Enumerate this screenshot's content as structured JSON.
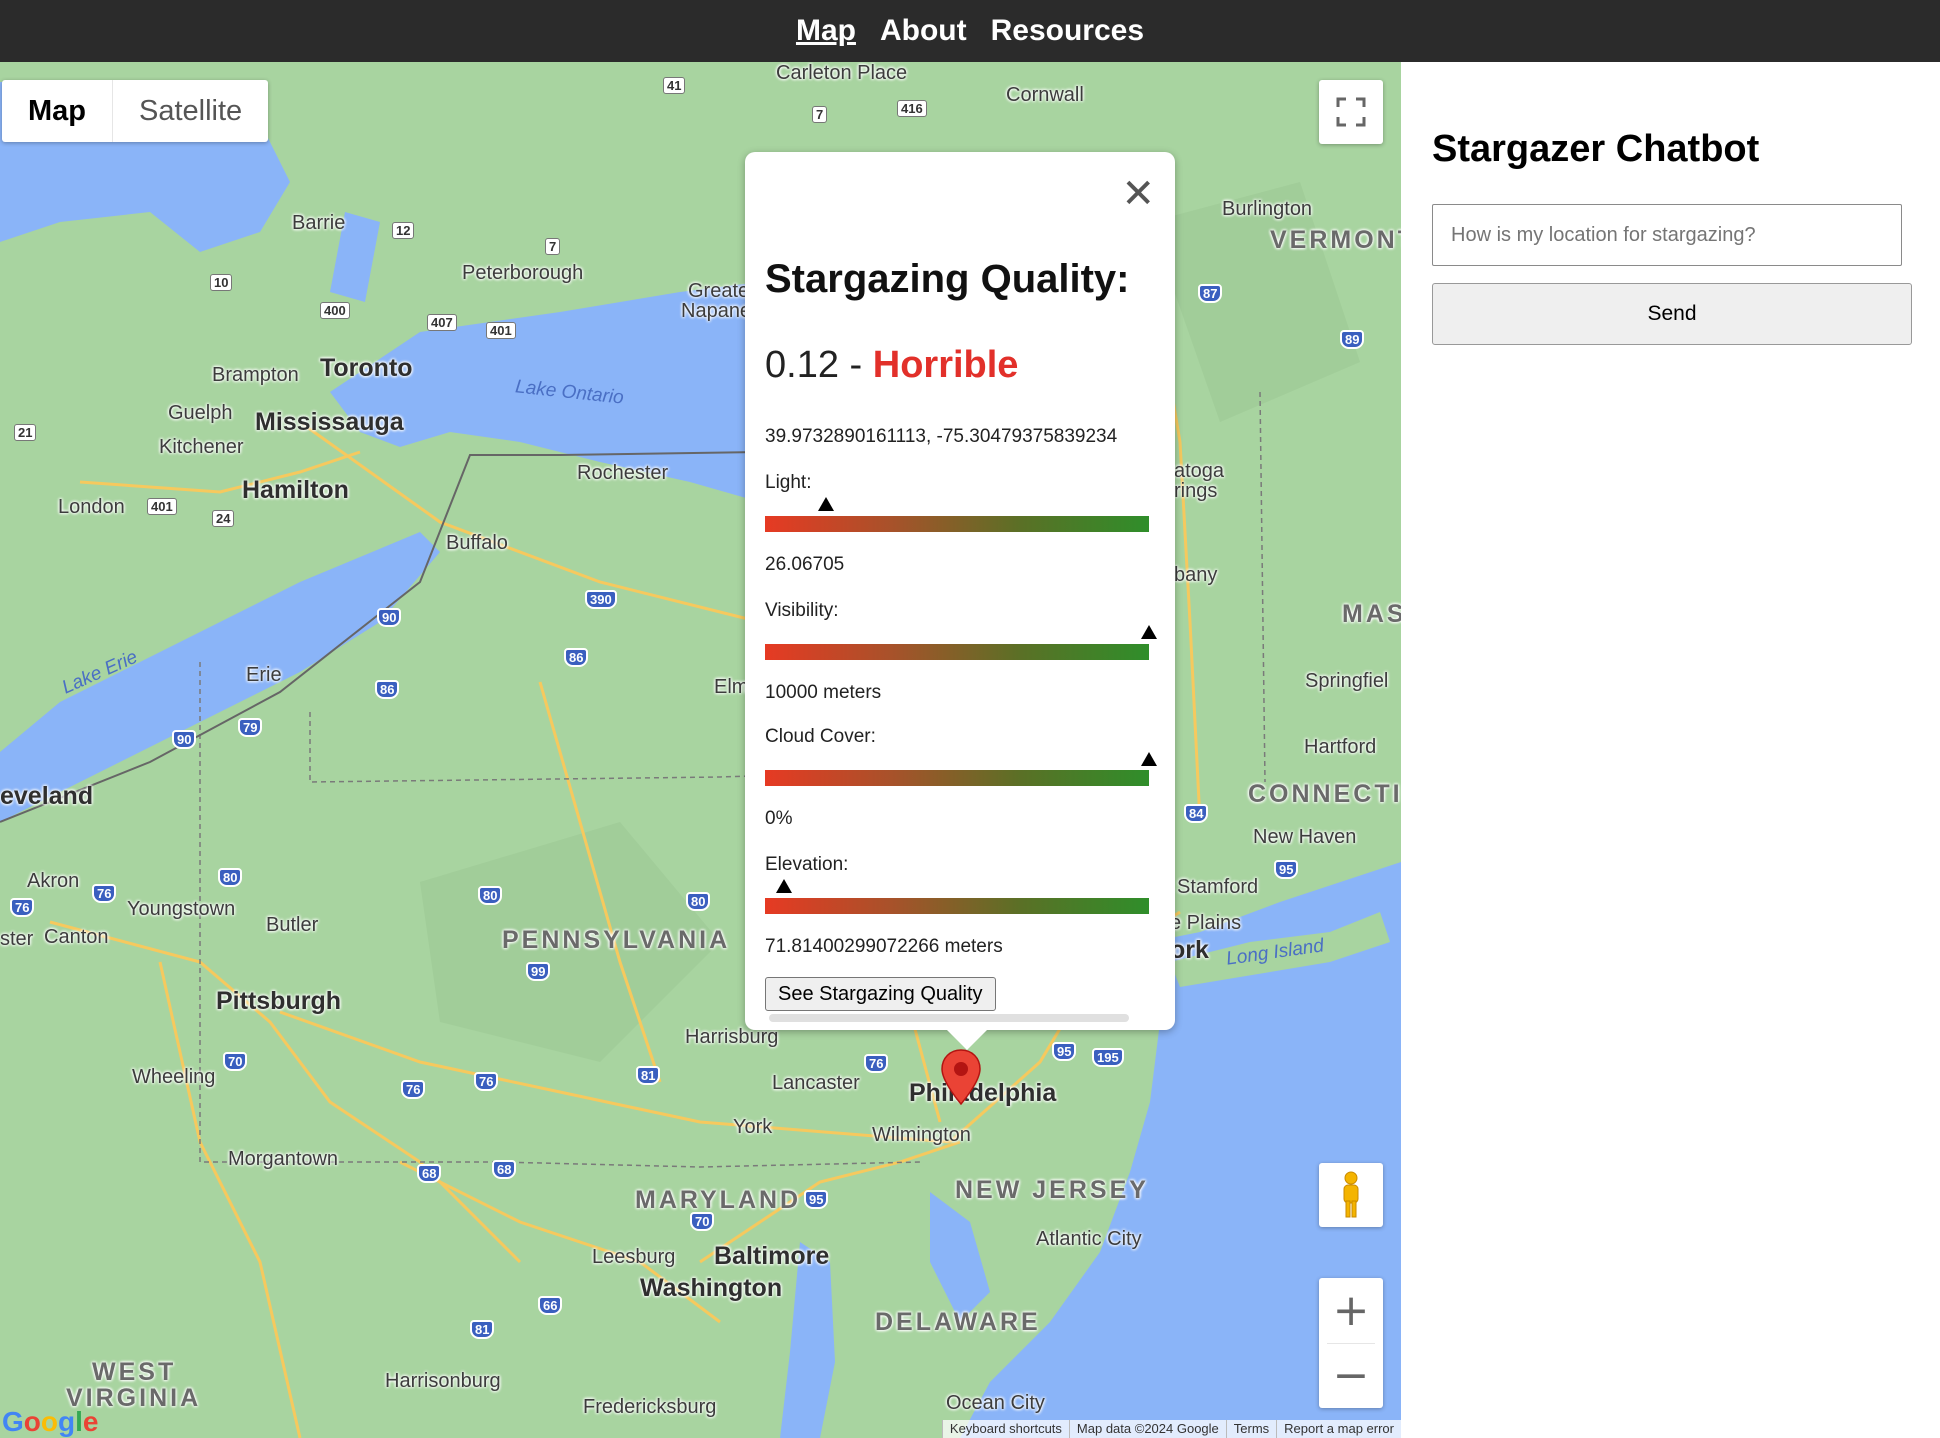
{
  "nav": {
    "items": [
      {
        "label": "Map",
        "active": true
      },
      {
        "label": "About",
        "active": false
      },
      {
        "label": "Resources",
        "active": false
      }
    ]
  },
  "map": {
    "type_control": {
      "map": "Map",
      "satellite": "Satellite",
      "selected": "Map"
    },
    "water_labels": {
      "lake_ontario": "Lake Ontario",
      "lake_erie": "Lake Erie",
      "long_island": "Long Island"
    },
    "state_labels": {
      "pennsylvania": "PENNSYLVANIA",
      "maryland": "MARYLAND",
      "new_jersey": "NEW JERSEY",
      "delaware": "DELAWARE",
      "west_virginia_1": "WEST",
      "west_virginia_2": "VIRGINIA",
      "vermont": "VERMONT",
      "mass": "MAS",
      "connecticut": "CONNECTIC"
    },
    "big_cities": {
      "toronto": "Toronto",
      "mississauga": "Mississauga",
      "hamilton": "Hamilton",
      "philadelphia": "Philadelphia",
      "pittsburgh": "Pittsburgh",
      "baltimore": "Baltimore",
      "washington": "Washington",
      "cleveland": "eveland"
    },
    "cities": {
      "carleton_place": "Carleton Place",
      "cornwall": "Cornwall",
      "burlington": "Burlington",
      "barrie": "Barrie",
      "peterborough": "Peterborough",
      "greater_napanee_1": "Greater",
      "greater_napanee_2": "Napane",
      "brampton": "Brampton",
      "guelph": "Guelph",
      "kitchener": "Kitchener",
      "london": "London",
      "rochester": "Rochester",
      "buffalo": "Buffalo",
      "erie": "Erie",
      "elmira": "Elm",
      "saratoga_1": "atoga",
      "saratoga_2": "rings",
      "albany": "bany",
      "springfield": "Springfiel",
      "hartford": "Hartford",
      "new_haven": "New Haven",
      "stamford": "Stamford",
      "white_plains": "e Plains",
      "new_york": "ork",
      "akron": "Akron",
      "youngstown": "Youngstown",
      "canton": "Canton",
      "ster": "ster",
      "butler": "Butler",
      "harrisburg": "Harrisburg",
      "lancaster": "Lancaster",
      "york": "York",
      "wilmington": "Wilmington",
      "wheeling": "Wheeling",
      "morgantown": "Morgantown",
      "leesburg": "Leesburg",
      "atlantic_city": "Atlantic City",
      "harrisonburg": "Harrisonburg",
      "fredericksburg": "Fredericksburg",
      "ocean_city": "Ocean City"
    },
    "shields": [
      "41",
      "416",
      "7",
      "12",
      "10",
      "400",
      "407",
      "401",
      "7",
      "87",
      "89",
      "21",
      "401",
      "24",
      "390",
      "90",
      "86",
      "86",
      "90",
      "79",
      "80",
      "76",
      "76",
      "80",
      "80",
      "99",
      "70",
      "76",
      "76",
      "81",
      "76",
      "95",
      "195",
      "68",
      "68",
      "70",
      "95",
      "66",
      "81",
      "84",
      "95"
    ],
    "attribution": {
      "shortcuts": "Keyboard shortcuts",
      "data": "Map data ©2024 Google",
      "terms": "Terms",
      "report": "Report a map error"
    },
    "logo_letters": [
      "G",
      "o",
      "o",
      "g",
      "l",
      "e"
    ],
    "zoom_in": "+",
    "zoom_out": "−"
  },
  "infowindow": {
    "close": "✕",
    "title": "Stargazing Quality:",
    "score": "0.12",
    "separator": " - ",
    "rating": "Horrible",
    "rating_color": "#e2302a",
    "coords": "39.9732890161113, -75.30479375839234",
    "metrics": [
      {
        "label": "Light:",
        "value": "26.06705",
        "level": 0.16
      },
      {
        "label": "Visibility:",
        "value": "10000 meters",
        "level": 1.0
      },
      {
        "label": "Cloud Cover:",
        "value": "0%",
        "level": 1.0
      },
      {
        "label": "Elevation:",
        "value": "71.81400299072266 meters",
        "level": 0.05
      }
    ],
    "button": "See Stargazing Quality"
  },
  "chat": {
    "title": "Stargazer Chatbot",
    "placeholder": "How is my location for stargazing?",
    "value": "",
    "send": "Send"
  }
}
